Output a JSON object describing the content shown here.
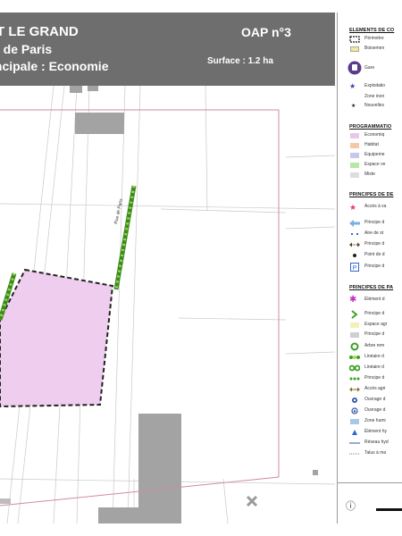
{
  "header": {
    "title_line1": "ET LE GRAND",
    "title_line2": "e de Paris",
    "title_line3": "incipale : Economie",
    "oap": "OAP n°3",
    "surface": "Surface : 1.2 ha"
  },
  "map": {
    "street_label": "Rue de Paris"
  },
  "legend": {
    "section1_title": "ELEMENTS DE CO",
    "section1_items": [
      {
        "label": "Périmètre",
        "icon": "dashed-rectangle-icon"
      },
      {
        "label": "Boisemen",
        "icon": "swatch-yellow"
      },
      {
        "label": "Gare",
        "icon": "train-station-icon"
      },
      {
        "label": "Exploitatio",
        "icon": "star-icon"
      },
      {
        "label": "Zone inon",
        "icon": "swatch-blank"
      },
      {
        "label": "Nouvelles",
        "icon": "star-small-icon"
      }
    ],
    "section2_title": "PROGRAMMATIO",
    "section2_items": [
      {
        "label": "Economiq",
        "color": "#e8c8e8"
      },
      {
        "label": "Habitat",
        "color": "#f5c9a8"
      },
      {
        "label": "Equipeme",
        "color": "#c6c6ee"
      },
      {
        "label": "Espace ve",
        "color": "#b7e8a4"
      },
      {
        "label": "Mixte",
        "color": "#dddddd"
      }
    ],
    "section3_title": "PRINCIPES DE DE",
    "section3_items": [
      {
        "label": "Accès à va",
        "icon": "pink-star-icon"
      },
      {
        "label": "Principe d",
        "icon": "blue-arrow-icon"
      },
      {
        "label": "Aire de st",
        "icon": "blue-dash-icon"
      },
      {
        "label": "Principe d",
        "icon": "double-arrow-icon"
      },
      {
        "label": "Point de d",
        "icon": "point-icon"
      },
      {
        "label": "Principe d",
        "icon": "parking-icon"
      }
    ],
    "section4_title": "PRINCIPES DE PA",
    "section4_items": [
      {
        "label": "Élément d",
        "icon": "magenta-star-icon"
      },
      {
        "label": "Principe d",
        "icon": "green-chevron-icon"
      },
      {
        "label": "Espace agr",
        "icon": "swatch-paleyellow"
      },
      {
        "label": "Principe d",
        "icon": "swatch-gray"
      },
      {
        "label": "Arbre rem",
        "icon": "green-ring-icon"
      },
      {
        "label": "Linéaire d",
        "icon": "tree-line-icon"
      },
      {
        "label": "Linéaire d",
        "icon": "double-ring-icon"
      },
      {
        "label": "Principe d",
        "icon": "green-dots-icon"
      },
      {
        "label": "Accès agri",
        "icon": "brown-arrow-icon"
      },
      {
        "label": "Ouvrage d",
        "icon": "blue-circle-icon"
      },
      {
        "label": "Ouvrage d",
        "icon": "blue-circle-outline-icon"
      },
      {
        "label": "Zone humi",
        "icon": "swatch-lightblue"
      },
      {
        "label": "Élément hy",
        "icon": "blue-triangle-icon"
      },
      {
        "label": "Réseau hyd",
        "icon": "blue-line-icon"
      },
      {
        "label": "Talus à ma",
        "icon": "dotted-line-icon"
      }
    ]
  }
}
